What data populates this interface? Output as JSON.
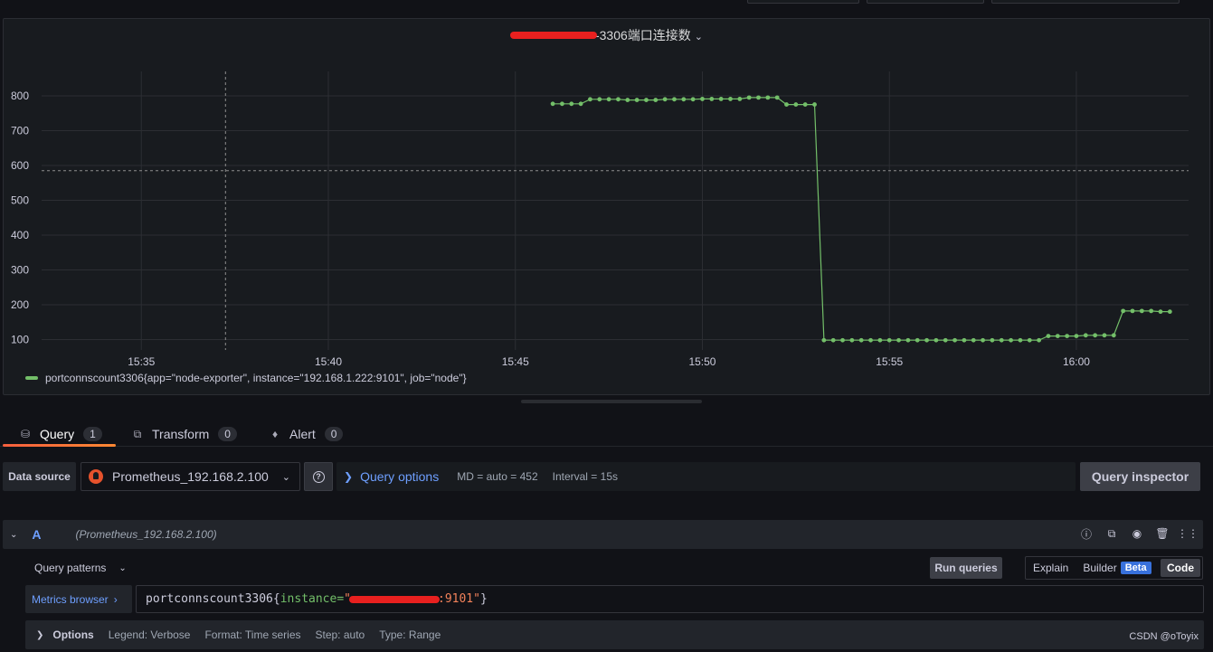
{
  "panel": {
    "title_suffix": "-3306端口连接数",
    "legend": "portconnscount3306{app=\"node-exporter\", instance=\"192.168.1.222:9101\", job=\"node\"}"
  },
  "chart_data": {
    "type": "line",
    "xlim": [
      "15:32:20",
      "16:03:00"
    ],
    "ylim": [
      70,
      870
    ],
    "x_ticks": [
      "15:35",
      "15:40",
      "15:45",
      "15:50",
      "15:55",
      "16:00"
    ],
    "y_ticks": [
      "100",
      "200",
      "300",
      "400",
      "500",
      "600",
      "700",
      "800"
    ],
    "grid": true,
    "threshold_line": 585,
    "crosshair_x": "15:37:15",
    "series": [
      {
        "name": "portconnscount3306{app=\"node-exporter\", instance=\"192.168.1.222:9101\", job=\"node\"}",
        "color": "#73bf69",
        "x": [
          "15:46:00",
          "15:46:15",
          "15:46:30",
          "15:46:45",
          "15:47:00",
          "15:47:15",
          "15:47:30",
          "15:47:45",
          "15:48:00",
          "15:48:15",
          "15:48:30",
          "15:48:45",
          "15:49:00",
          "15:49:15",
          "15:49:30",
          "15:49:45",
          "15:50:00",
          "15:50:15",
          "15:50:30",
          "15:50:45",
          "15:51:00",
          "15:51:15",
          "15:51:30",
          "15:51:45",
          "15:52:00",
          "15:52:15",
          "15:52:30",
          "15:52:45",
          "15:53:00",
          "15:53:15",
          "15:53:30",
          "15:53:45",
          "15:54:00",
          "15:54:15",
          "15:54:30",
          "15:54:45",
          "15:55:00",
          "15:55:15",
          "15:55:30",
          "15:55:45",
          "15:56:00",
          "15:56:15",
          "15:56:30",
          "15:56:45",
          "15:57:00",
          "15:57:15",
          "15:57:30",
          "15:57:45",
          "15:58:00",
          "15:58:15",
          "15:58:30",
          "15:58:45",
          "15:59:00",
          "15:59:15",
          "15:59:30",
          "15:59:45",
          "16:00:00",
          "16:00:15",
          "16:00:30",
          "16:00:45",
          "16:01:00",
          "16:01:15",
          "16:01:30",
          "16:01:45",
          "16:02:00",
          "16:02:15",
          "16:02:30"
        ],
        "y": [
          777,
          777,
          777,
          777,
          790,
          790,
          790,
          790,
          788,
          788,
          788,
          788,
          790,
          790,
          790,
          790,
          791,
          791,
          791,
          791,
          791,
          795,
          795,
          795,
          795,
          775,
          775,
          775,
          775,
          98,
          98,
          98,
          98,
          98,
          98,
          98,
          98,
          98,
          98,
          98,
          98,
          98,
          98,
          98,
          98,
          98,
          98,
          98,
          98,
          98,
          98,
          98,
          98,
          110,
          110,
          110,
          110,
          112,
          112,
          112,
          112,
          182,
          182,
          182,
          182,
          180,
          180
        ]
      }
    ]
  },
  "tabs": [
    {
      "label": "Query",
      "count": "1",
      "icon": "database-icon"
    },
    {
      "label": "Transform",
      "count": "0",
      "icon": "transform-icon"
    },
    {
      "label": "Alert",
      "count": "0",
      "icon": "bell-icon"
    }
  ],
  "query_bar": {
    "data_source_label": "Data source",
    "data_source_value": "Prometheus_192.168.2.100",
    "query_options_label": "Query options",
    "md": "MD = auto = 452",
    "interval": "Interval = 15s",
    "inspector_label": "Query inspector"
  },
  "query": {
    "letter": "A",
    "datasource_hint": "(Prometheus_192.168.2.100)",
    "patterns_label": "Query patterns",
    "run_label": "Run queries",
    "mode_explain": "Explain",
    "mode_builder": "Builder",
    "mode_beta": "Beta",
    "mode_code": "Code",
    "metrics_browser": "Metrics browser",
    "expr_metric": "portconnscount3306",
    "expr_open": "{",
    "expr_label": "instance=",
    "expr_quote": "\"",
    "expr_tail": ":9101\"",
    "expr_close": "}",
    "options_label": "Options",
    "opt_legend": "Legend: Verbose",
    "opt_format": "Format: Time series",
    "opt_step": "Step: auto",
    "opt_type": "Type: Range"
  },
  "watermark": "CSDN @oToyix"
}
